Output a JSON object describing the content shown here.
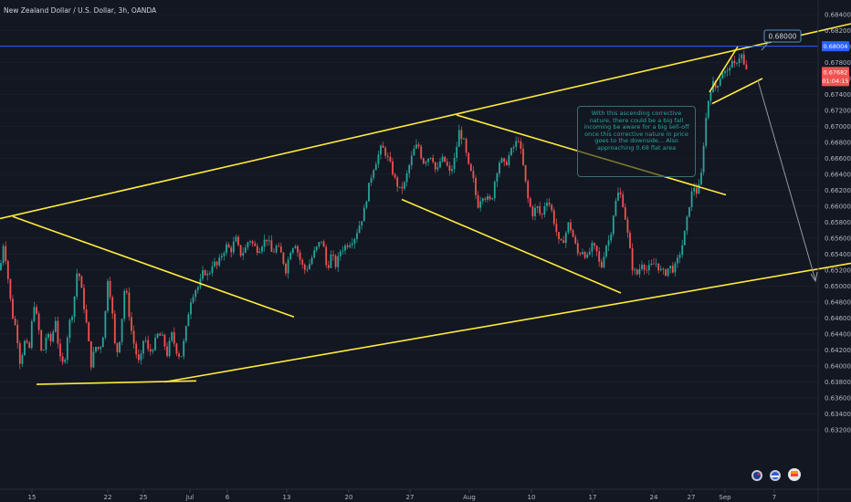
{
  "header": {
    "title": "New Zealand Dollar / U.S. Dollar, 3h, OANDA"
  },
  "price_scale": {
    "ticks": [
      "0.68400",
      "0.68200",
      "0.68000",
      "0.67800",
      "0.67600",
      "0.67400",
      "0.67200",
      "0.67000",
      "0.66800",
      "0.66600",
      "0.66400",
      "0.66200",
      "0.66000",
      "0.65800",
      "0.65600",
      "0.65400",
      "0.65200",
      "0.65000",
      "0.64800",
      "0.64600",
      "0.64400",
      "0.64200",
      "0.64000",
      "0.63800",
      "0.63600",
      "0.63400",
      "0.63200"
    ],
    "horizontal_line_label": "0.68004",
    "current_price_label": "0.67682",
    "countdown_label": "01:04:15"
  },
  "time_scale": {
    "ticks": [
      "15",
      "22",
      "25",
      "Jul",
      "6",
      "13",
      "20",
      "27",
      "Aug",
      "10",
      "17",
      "24",
      "27",
      "Sep",
      "7"
    ]
  },
  "annotations": {
    "target_label": "0.68000",
    "note": "With this ascending corrective nature, there could be a big fall incoming be aware for a big sell-off once this corrective nature in price goes to the downside... Also approaching 0.68 flat area"
  },
  "colors": {
    "background": "#131722",
    "up": "#26a69a",
    "down": "#ef5350",
    "trendline": "#ffeb3b",
    "hline": "#2962ff",
    "text": "#b2b5be",
    "note_text": "#26a69a"
  },
  "chart_data": {
    "type": "candlestick",
    "title": "New Zealand Dollar / U.S. Dollar, 3h, OANDA",
    "ylim": [
      0.6312,
      0.685
    ],
    "horizontal_line": 0.68004,
    "last_price": 0.67682,
    "price_path": [
      [
        0,
        0.652
      ],
      [
        4,
        0.6556
      ],
      [
        8,
        0.6518
      ],
      [
        13,
        0.6466
      ],
      [
        18,
        0.6445
      ],
      [
        22,
        0.6404
      ],
      [
        27,
        0.643
      ],
      [
        32,
        0.642
      ],
      [
        37,
        0.648
      ],
      [
        42,
        0.645
      ],
      [
        46,
        0.641
      ],
      [
        51,
        0.644
      ],
      [
        56,
        0.643
      ],
      [
        61,
        0.646
      ],
      [
        65,
        0.641
      ],
      [
        70,
        0.64
      ],
      [
        75,
        0.645
      ],
      [
        80,
        0.647
      ],
      [
        85,
        0.6525
      ],
      [
        90,
        0.649
      ],
      [
        95,
        0.645
      ],
      [
        100,
        0.64
      ],
      [
        104,
        0.6425
      ],
      [
        109,
        0.642
      ],
      [
        114,
        0.6445
      ],
      [
        118,
        0.651
      ],
      [
        122,
        0.648
      ],
      [
        127,
        0.641
      ],
      [
        132,
        0.644
      ],
      [
        137,
        0.6505
      ],
      [
        143,
        0.645
      ],
      [
        148,
        0.642
      ],
      [
        153,
        0.64
      ],
      [
        158,
        0.644
      ],
      [
        163,
        0.6415
      ],
      [
        168,
        0.6425
      ],
      [
        173,
        0.644
      ],
      [
        178,
        0.6435
      ],
      [
        183,
        0.6415
      ],
      [
        188,
        0.644
      ],
      [
        193,
        0.642
      ],
      [
        198,
        0.641
      ],
      [
        203,
        0.644
      ],
      [
        208,
        0.648
      ],
      [
        213,
        0.6495
      ],
      [
        218,
        0.65
      ],
      [
        223,
        0.652
      ],
      [
        228,
        0.6512
      ],
      [
        233,
        0.653
      ],
      [
        238,
        0.6525
      ],
      [
        243,
        0.654
      ],
      [
        248,
        0.655
      ],
      [
        253,
        0.6545
      ],
      [
        258,
        0.656
      ],
      [
        263,
        0.654
      ],
      [
        268,
        0.6545
      ],
      [
        273,
        0.656
      ],
      [
        278,
        0.655
      ],
      [
        283,
        0.6545
      ],
      [
        288,
        0.6555
      ],
      [
        293,
        0.656
      ],
      [
        298,
        0.654
      ],
      [
        303,
        0.655
      ],
      [
        308,
        0.654
      ],
      [
        313,
        0.652
      ],
      [
        318,
        0.6545
      ],
      [
        323,
        0.6555
      ],
      [
        328,
        0.6535
      ],
      [
        333,
        0.652
      ],
      [
        338,
        0.6525
      ],
      [
        343,
        0.654
      ],
      [
        348,
        0.655
      ],
      [
        353,
        0.656
      ],
      [
        358,
        0.652
      ],
      [
        363,
        0.654
      ],
      [
        368,
        0.6525
      ],
      [
        373,
        0.6545
      ],
      [
        378,
        0.655
      ],
      [
        383,
        0.6555
      ],
      [
        388,
        0.656
      ],
      [
        393,
        0.6575
      ],
      [
        398,
        0.659
      ],
      [
        403,
        0.662
      ],
      [
        408,
        0.6645
      ],
      [
        413,
        0.666
      ],
      [
        418,
        0.6675
      ],
      [
        423,
        0.6665
      ],
      [
        428,
        0.665
      ],
      [
        433,
        0.6632
      ],
      [
        438,
        0.662
      ],
      [
        443,
        0.6628
      ],
      [
        448,
        0.665
      ],
      [
        453,
        0.667
      ],
      [
        458,
        0.6678
      ],
      [
        463,
        0.6655
      ],
      [
        468,
        0.666
      ],
      [
        473,
        0.6665
      ],
      [
        478,
        0.664
      ],
      [
        483,
        0.666
      ],
      [
        488,
        0.6655
      ],
      [
        493,
        0.664
      ],
      [
        498,
        0.666
      ],
      [
        503,
        0.6695
      ],
      [
        508,
        0.668
      ],
      [
        513,
        0.665
      ],
      [
        518,
        0.6635
      ],
      [
        523,
        0.66
      ],
      [
        528,
        0.6615
      ],
      [
        533,
        0.661
      ],
      [
        538,
        0.6605
      ],
      [
        543,
        0.664
      ],
      [
        548,
        0.666
      ],
      [
        553,
        0.665
      ],
      [
        558,
        0.6665
      ],
      [
        563,
        0.6675
      ],
      [
        568,
        0.6685
      ],
      [
        573,
        0.665
      ],
      [
        578,
        0.661
      ],
      [
        583,
        0.659
      ],
      [
        588,
        0.66
      ],
      [
        593,
        0.6585
      ],
      [
        598,
        0.661
      ],
      [
        603,
        0.66
      ],
      [
        608,
        0.6575
      ],
      [
        613,
        0.655
      ],
      [
        618,
        0.656
      ],
      [
        623,
        0.658
      ],
      [
        628,
        0.656
      ],
      [
        633,
        0.654
      ],
      [
        638,
        0.6545
      ],
      [
        643,
        0.6535
      ],
      [
        648,
        0.655
      ],
      [
        653,
        0.6545
      ],
      [
        658,
        0.652
      ],
      [
        663,
        0.655
      ],
      [
        668,
        0.656
      ],
      [
        673,
        0.66
      ],
      [
        678,
        0.662
      ],
      [
        683,
        0.66
      ],
      [
        688,
        0.656
      ],
      [
        693,
        0.652
      ],
      [
        698,
        0.6515
      ],
      [
        703,
        0.653
      ],
      [
        708,
        0.652
      ],
      [
        713,
        0.6525
      ],
      [
        718,
        0.653
      ],
      [
        723,
        0.652
      ],
      [
        728,
        0.6515
      ],
      [
        733,
        0.6525
      ],
      [
        738,
        0.652
      ],
      [
        743,
        0.6535
      ],
      [
        748,
        0.6555
      ],
      [
        752,
        0.658
      ],
      [
        756,
        0.661
      ],
      [
        760,
        0.6625
      ],
      [
        764,
        0.6615
      ],
      [
        768,
        0.664
      ],
      [
        772,
        0.67
      ],
      [
        776,
        0.6735
      ],
      [
        780,
        0.6755
      ],
      [
        784,
        0.6748
      ],
      [
        788,
        0.676
      ],
      [
        792,
        0.677
      ],
      [
        796,
        0.6765
      ],
      [
        800,
        0.678
      ],
      [
        804,
        0.6775
      ],
      [
        808,
        0.6785
      ],
      [
        812,
        0.679
      ],
      [
        816,
        0.677
      ],
      [
        820,
        0.6768
      ]
    ],
    "trendlines": [
      {
        "name": "channel-upper",
        "points": [
          [
            0,
            0.65846
          ],
          [
            932,
            0.68286
          ]
        ]
      },
      {
        "name": "channel-lower",
        "points": [
          [
            180,
            0.638
          ],
          [
            932,
            0.65286
          ]
        ]
      },
      {
        "name": "lower-left-base",
        "points": [
          [
            40,
            0.63771
          ],
          [
            215,
            0.63814
          ]
        ]
      },
      {
        "name": "descending-1",
        "points": [
          [
            14,
            0.65871
          ],
          [
            322,
            0.64614
          ]
        ]
      },
      {
        "name": "descending-2-top",
        "points": [
          [
            500,
            0.67143
          ],
          [
            795,
            0.66143
          ]
        ]
      },
      {
        "name": "descending-2-bottom",
        "points": [
          [
            440,
            0.66086
          ],
          [
            680,
            0.64914
          ]
        ]
      },
      {
        "name": "wedge-top",
        "points": [
          [
            777,
            0.67429
          ],
          [
            808,
            0.68
          ]
        ]
      },
      {
        "name": "wedge-bottom",
        "points": [
          [
            780,
            0.67286
          ],
          [
            835,
            0.676
          ]
        ]
      }
    ]
  }
}
